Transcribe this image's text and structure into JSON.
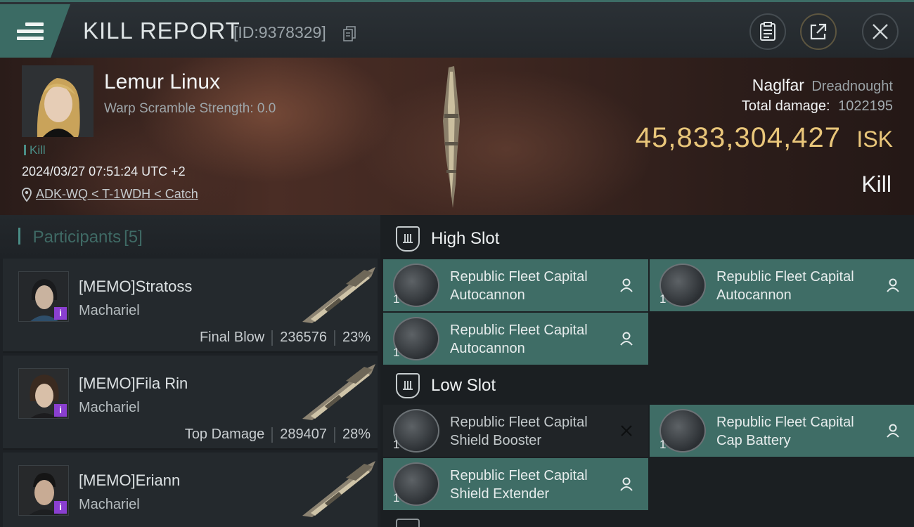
{
  "header": {
    "title": "KILL REPORT",
    "report_id": "[ID:9378329]"
  },
  "victim": {
    "name": "Lemur Linux",
    "warp_scramble": "Warp Scramble Strength: 0.0",
    "tag": "Kill",
    "datetime": "2024/03/27 07:51:24 UTC +2",
    "location": "ADK-WQ < T-1WDH < Catch",
    "ship_name": "Naglfar",
    "ship_class": "Dreadnought",
    "total_damage_label": "Total damage:",
    "total_damage": "1022195",
    "isk_value": "45,833,304,427",
    "isk_unit": "ISK",
    "result": "Kill"
  },
  "participants": {
    "label": "Participants",
    "count": "[5]",
    "items": [
      {
        "name": "[MEMO]Stratoss",
        "ship": "Machariel",
        "role": "Final Blow",
        "damage": "236576",
        "percent": "23%"
      },
      {
        "name": "[MEMO]Fila Rin",
        "ship": "Machariel",
        "role": "Top Damage",
        "damage": "289407",
        "percent": "28%"
      },
      {
        "name": "[MEMO]Eriann",
        "ship": "Machariel",
        "role": "",
        "damage": "",
        "percent": ""
      }
    ]
  },
  "slots": {
    "high": {
      "label": "High Slot",
      "items": [
        {
          "name": "Republic Fleet Capital Autocannon",
          "qty": "1"
        },
        {
          "name": "Republic Fleet Capital Autocannon",
          "qty": "1"
        },
        {
          "name": "Republic Fleet Capital Autocannon",
          "qty": "1"
        }
      ]
    },
    "low": {
      "label": "Low Slot",
      "items": [
        {
          "name": "Republic Fleet Capital Shield Booster",
          "qty": "1"
        },
        {
          "name": "Republic Fleet Capital Cap Battery",
          "qty": "1"
        },
        {
          "name": "Republic Fleet Capital Shield Extender",
          "qty": "1"
        }
      ]
    }
  },
  "colors": {
    "accent_teal": "#3f6d66",
    "isk_gold": "#e9c67a",
    "badge_purple": "#8a3fd0"
  },
  "icons": [
    "menu-icon",
    "copy-icon",
    "clipboard-icon",
    "share-icon",
    "close-icon",
    "location-pin-icon",
    "person-icon",
    "x-icon",
    "slot-icon"
  ]
}
